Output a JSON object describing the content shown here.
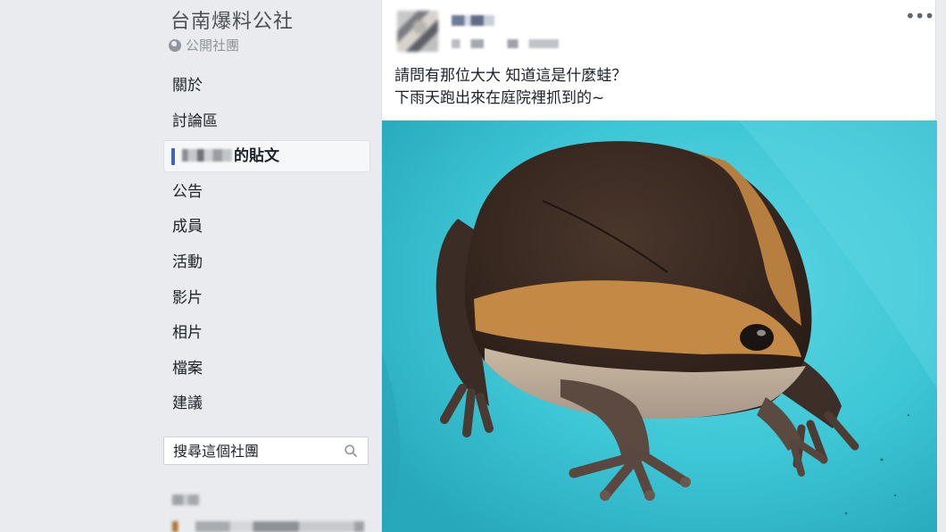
{
  "group": {
    "title": "台南爆料公社",
    "privacy": "公開社團",
    "privacy_icon": "globe-icon"
  },
  "nav": {
    "items": [
      "關於",
      "討論區",
      "的貼文",
      "公告",
      "成員",
      "活動",
      "影片",
      "相片",
      "檔案",
      "建議"
    ],
    "active_index": 2
  },
  "search": {
    "placeholder": "搜尋這個社團"
  },
  "post": {
    "line1": "請問有那位大大 知道這是什麼蛙？",
    "line2": "下雨天跑出來在庭院裡抓到的~"
  },
  "colors": {
    "page_bg": "#e9ebee",
    "accent": "#4267b2",
    "bucket_blue": "#3ec7d6",
    "frog_dark": "#3a2a22",
    "frog_orange": "#c48a45"
  }
}
